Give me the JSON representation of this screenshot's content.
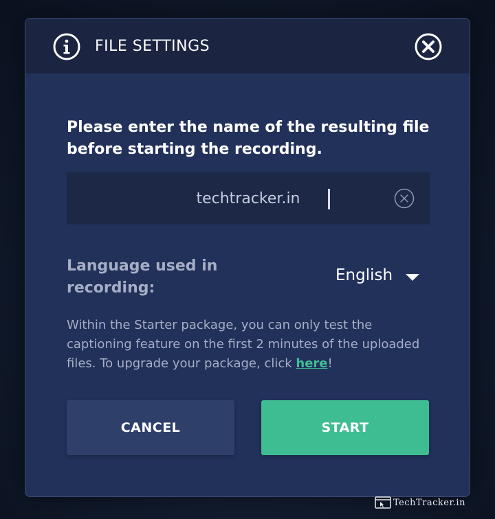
{
  "dialog": {
    "title": "FILE SETTINGS",
    "info_icon": "info-icon",
    "close_icon": "close-icon"
  },
  "form": {
    "prompt": "Please enter the name of the resulting file before starting the recording.",
    "filename_value": "techtracker.in",
    "clear_icon": "clear-icon",
    "language_label": "Language used in recording:",
    "language_value": "English",
    "dropdown_icon": "chevron-down-icon"
  },
  "note": {
    "text_before": "Within the Starter package, you can only test the captioning feature on the first 2 minutes of the uploaded files. To upgrade your package, click ",
    "link": "here",
    "text_after": "!"
  },
  "buttons": {
    "cancel": "CANCEL",
    "start": "START"
  },
  "colors": {
    "dialog_bg": "#22315a",
    "header_bg": "#1b2440",
    "accent": "#3ebd93",
    "cancel_bg": "#2e3f6a"
  },
  "watermark": "TechTracker.in"
}
